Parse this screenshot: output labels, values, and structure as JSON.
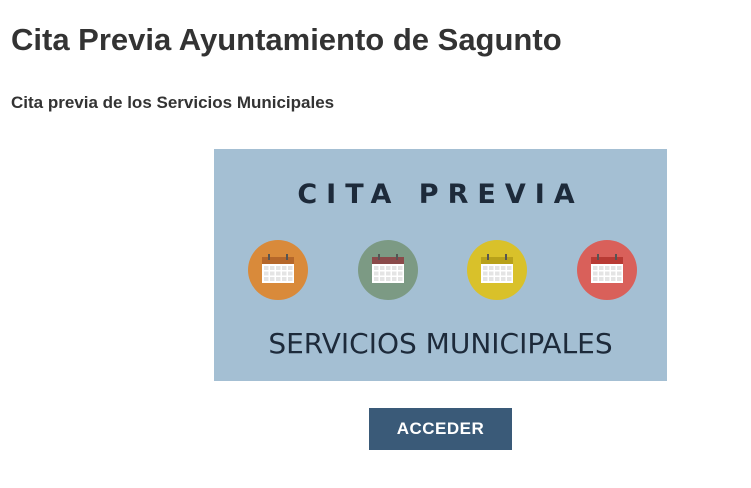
{
  "page": {
    "title": "Cita Previa Ayuntamiento de Sagunto",
    "subtitle": "Cita previa de los Servicios Municipales"
  },
  "banner": {
    "top_text": "CITA PREVIA",
    "bottom_text": "SERVICIOS MUNICIPALES",
    "background_color": "#a4bfd3",
    "icons": [
      {
        "name": "calendar-icon",
        "circle_color": "#d98a3a",
        "header_color": "#b5672a"
      },
      {
        "name": "calendar-icon",
        "circle_color": "#7c9a84",
        "header_color": "#8a4a4a"
      },
      {
        "name": "calendar-icon",
        "circle_color": "#d9c12a",
        "header_color": "#b8a11a"
      },
      {
        "name": "calendar-icon",
        "circle_color": "#d9605a",
        "header_color": "#b83a34"
      }
    ]
  },
  "cta": {
    "label": "ACCEDER",
    "color": "#3a5a78"
  }
}
